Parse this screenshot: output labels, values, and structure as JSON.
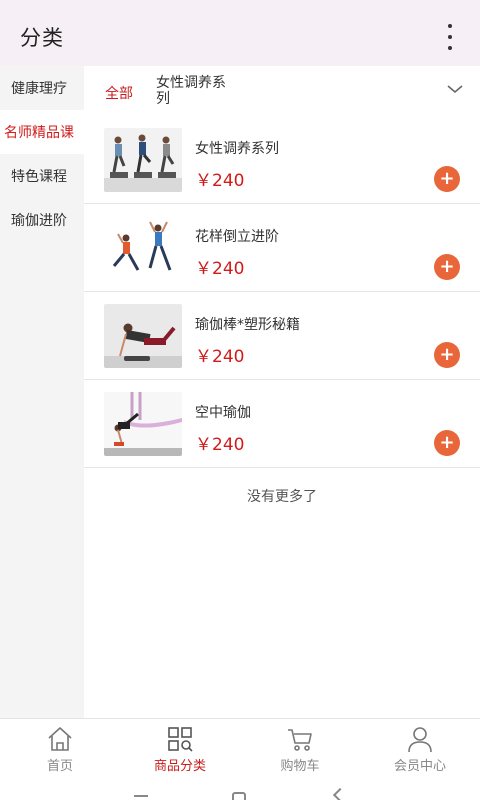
{
  "header": {
    "title": "分类"
  },
  "sidebar": {
    "items": [
      {
        "label": "健康理疗"
      },
      {
        "label": "名师精品课",
        "active": true
      },
      {
        "label": "特色课程"
      },
      {
        "label": "瑜伽进阶"
      }
    ]
  },
  "filter": {
    "all_label": "全部",
    "current_label": "女性调养系列"
  },
  "products": [
    {
      "name": "女性调养系列",
      "price": "￥240"
    },
    {
      "name": "花样倒立进阶",
      "price": "￥240"
    },
    {
      "name": "瑜伽棒*塑形秘籍",
      "price": "￥240"
    },
    {
      "name": "空中瑜伽",
      "price": "￥240"
    }
  ],
  "list_end_text": "没有更多了",
  "tabbar": {
    "items": [
      {
        "label": "首页",
        "icon": "home-icon"
      },
      {
        "label": "商品分类",
        "icon": "category-icon",
        "active": true
      },
      {
        "label": "购物车",
        "icon": "cart-icon"
      },
      {
        "label": "会员中心",
        "icon": "user-icon"
      }
    ]
  },
  "colors": {
    "accent_red": "#c81d1d",
    "add_button": "#e8663a",
    "header_bg": "#f6f0f6",
    "sidebar_bg": "#f4f4f4"
  }
}
